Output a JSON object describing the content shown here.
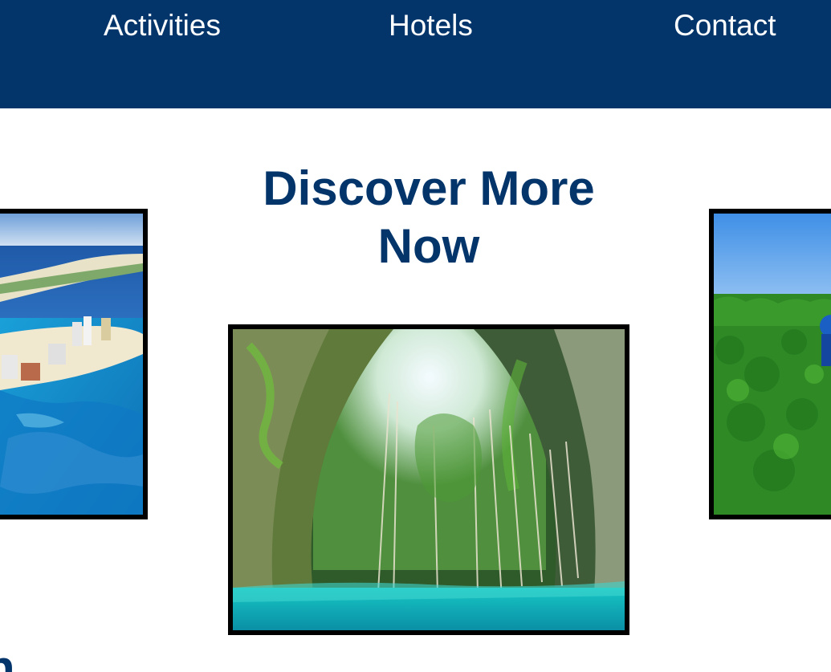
{
  "nav": {
    "items": [
      {
        "label": "Activities"
      },
      {
        "label": "Hotels"
      },
      {
        "label": "Contact"
      }
    ]
  },
  "main": {
    "heading": "Discover More Now",
    "partial_heading_fragment": "n"
  },
  "colors": {
    "brand_navy": "#03356b",
    "background": "#ffffff",
    "photo_border": "#000000"
  }
}
